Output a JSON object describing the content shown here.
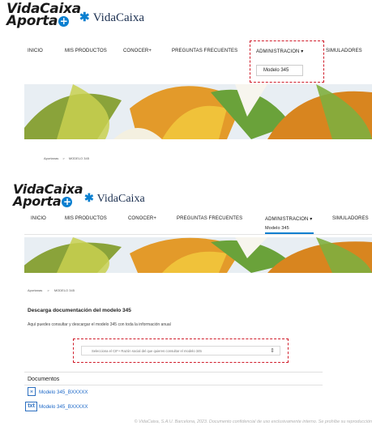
{
  "header1": {
    "logo_line1": "VidaCaixa",
    "logo_line2": "Aporta",
    "plus": "+",
    "brand": "VidaCaixa",
    "nav": [
      "INICIO",
      "MIS PRODUCTOS",
      "CONOCER+",
      "PREGUNTAS FRECUENTES",
      "ADMINISTRACION",
      "SIMULADORES"
    ],
    "dropdown_item": "Modelo 345"
  },
  "breadcrumb1": [
    "Aportanas",
    ">",
    "MODELO 345"
  ],
  "header2": {
    "logo_line1": "VidaCaixa",
    "logo_line2": "Aporta",
    "plus": "+",
    "brand": "VidaCaixa",
    "nav": [
      "INICIO",
      "MIS PRODUCTOS",
      "CONOCER+",
      "PREGUNTAS FRECUENTES",
      "ADMINISTRACION",
      "SIMULADORES"
    ],
    "dropdown_item": "Modelo 345"
  },
  "breadcrumb2": [
    "Aportanas",
    ">",
    "MODELO 345"
  ],
  "content": {
    "heading": "Descarga documentación del modelo 345",
    "description": "Aquí puedes consultar y descargar el modelo 345 con toda la información anual",
    "select_placeholder": "Selecciona el CIF+ Razón social del que quieres consultar el modelo 345"
  },
  "documents": {
    "title": "Documentos",
    "items": [
      {
        "icon": "pdf-icon",
        "label": "Modelo 345_BXXXXX"
      },
      {
        "icon": "txt-icon",
        "label": "Modelo 345_BXXXXX"
      }
    ]
  },
  "footer": "© VidaCaixa, S.A.U. Barcelona, 2023. Documento confidencial de uso exclusivamente interno. Se prohíbe su reproducción",
  "colors": {
    "accent": "#0a7fd0",
    "highlight": "#d01c2a",
    "link": "#1b67c7"
  }
}
